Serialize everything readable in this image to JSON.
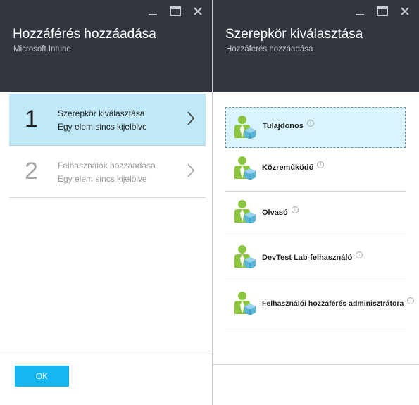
{
  "left_blade": {
    "title": "Hozzáférés hozzáadása",
    "subtitle": "Microsoft.Intune",
    "steps": [
      {
        "number": "1",
        "title": "Szerepkör kiválasztása",
        "status": "Egy elem sincs kijelölve"
      },
      {
        "number": "2",
        "title": "Felhasználók hozzáadása",
        "status": "Egy elem sincs kijelölve"
      }
    ],
    "ok_label": "OK"
  },
  "right_blade": {
    "title": "Szerepkör kiválasztása",
    "subtitle": "Hozzáférés hozzáadása",
    "roles": [
      {
        "label": "Tulajdonos",
        "info": "i"
      },
      {
        "label": "Közreműködő",
        "info": "i"
      },
      {
        "label": "Olvasó",
        "info": "i"
      },
      {
        "label": "DevTest Lab-felhasználó",
        "info": "i"
      },
      {
        "label": "Felhasználói hozzáférés adminisztrátora",
        "info": "i"
      }
    ]
  },
  "colors": {
    "header_bg": "#32363f",
    "selected_step_bg": "#bfe9f8",
    "selected_role_bg": "#d9f4fc",
    "ok_button": "#14b7ef",
    "icon_green": "#8cc63f",
    "icon_blue": "#59b4d9"
  },
  "icons": {
    "minimize": "minimize-icon",
    "maximize": "maximize-icon",
    "close": "close-icon",
    "chevron": "chevron-right-icon",
    "role": "user-role-icon",
    "info": "info-icon"
  }
}
